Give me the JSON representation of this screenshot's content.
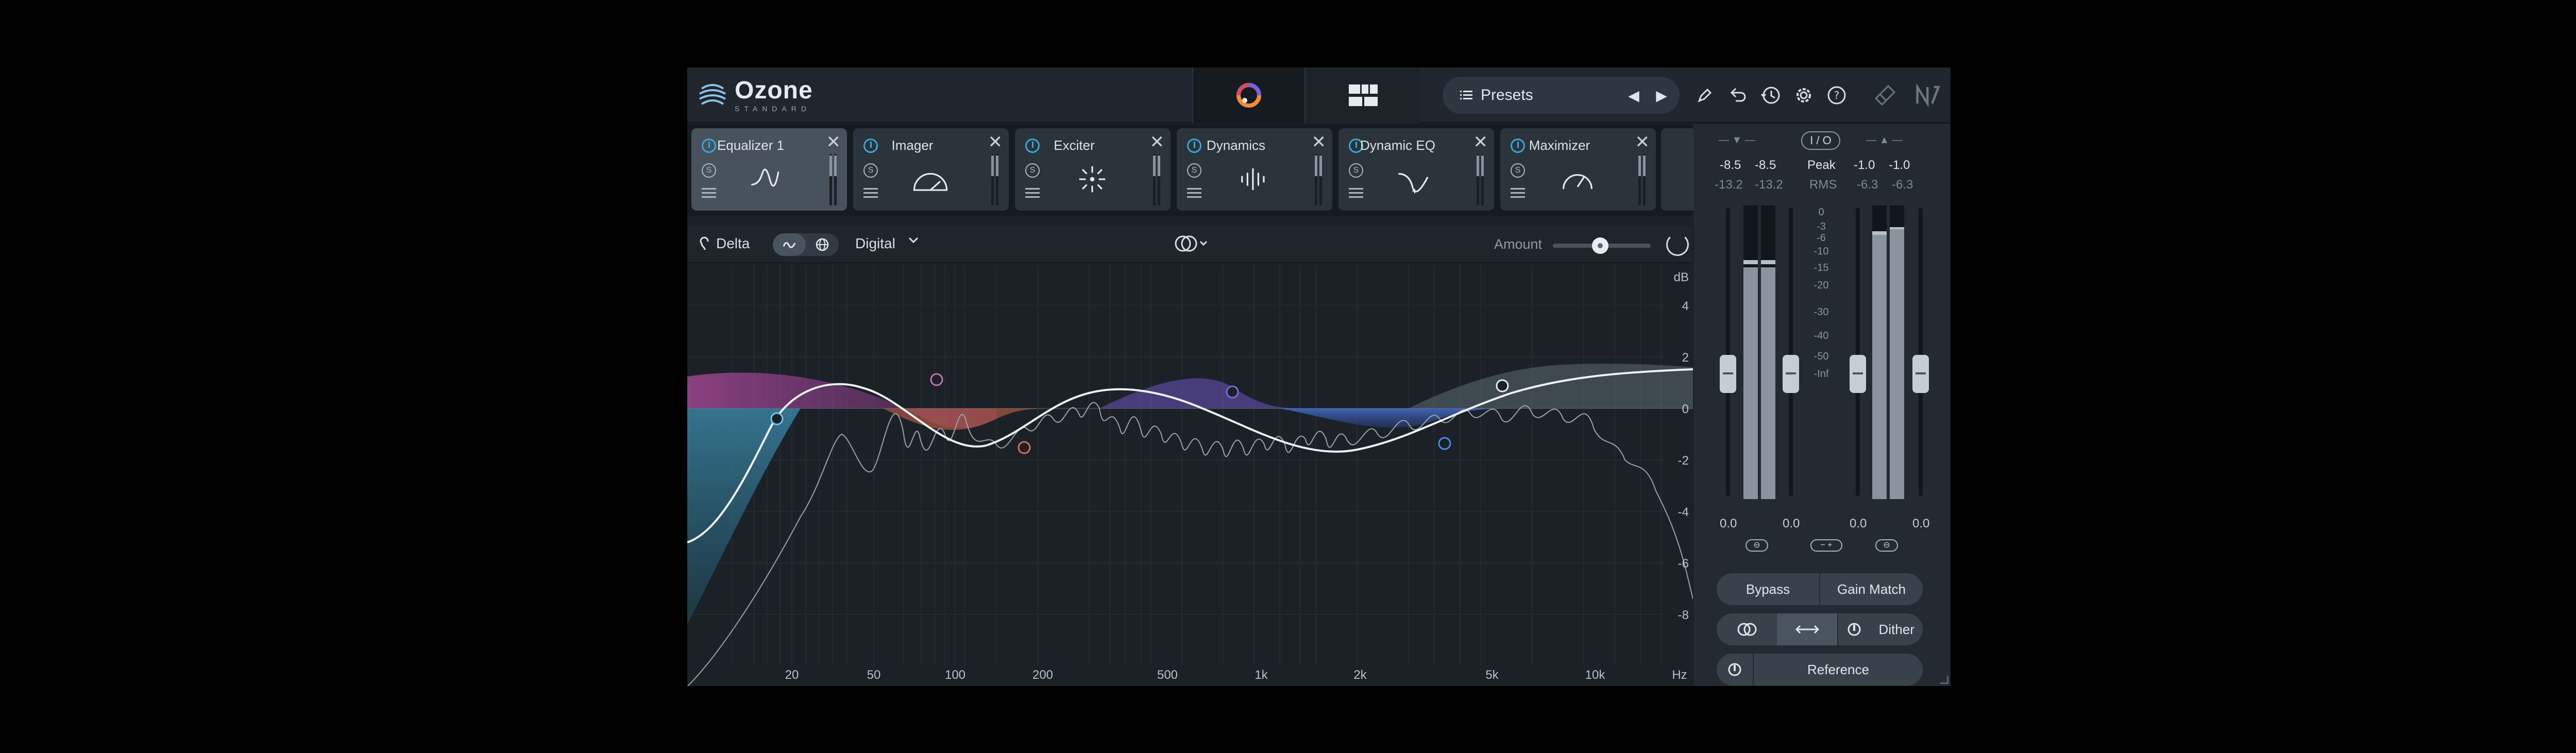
{
  "app": {
    "logo_title": "Ozone",
    "logo_subtitle": "STANDARD"
  },
  "topbar": {
    "presets_label": "Presets",
    "icons": [
      "ring-visualizer-icon",
      "module-grid-icon",
      "pencil-icon",
      "undo-icon",
      "history-icon",
      "gear-icon",
      "help-icon",
      "plugin-link-icon",
      "ni-logo-icon"
    ]
  },
  "modules": [
    {
      "name": "Equalizer 1",
      "active": true,
      "icon": "eq-curve-icon"
    },
    {
      "name": "Imager",
      "active": false,
      "icon": "imager-arc-icon"
    },
    {
      "name": "Exciter",
      "active": false,
      "icon": "exciter-burst-icon"
    },
    {
      "name": "Dynamics",
      "active": false,
      "icon": "dynamics-bars-icon"
    },
    {
      "name": "Dynamic EQ",
      "active": false,
      "icon": "dynamic-eq-icon"
    },
    {
      "name": "Maximizer",
      "active": false,
      "icon": "maximizer-gauge-icon"
    }
  ],
  "module_controls": {
    "solo": "S",
    "close": "✕"
  },
  "eq_header": {
    "delta_label": "Delta",
    "mode_label": "Digital",
    "amount_label": "Amount",
    "amount_value": 0.5
  },
  "graph": {
    "y_unit": "dB",
    "y_ticks": [
      "4",
      "2",
      "0",
      "-2",
      "-4",
      "-6",
      "-8"
    ],
    "x_unit": "Hz",
    "x_ticks": [
      "20",
      "50",
      "100",
      "200",
      "500",
      "1k",
      "2k",
      "5k",
      "10k"
    ]
  },
  "meters": {
    "io_label": "I / O",
    "input_peak": [
      "-8.5",
      "-8.5"
    ],
    "input_rms": [
      "-13.2",
      "-13.2"
    ],
    "peak_label": "Peak",
    "rms_label": "RMS",
    "output_peak": [
      "-1.0",
      "-1.0"
    ],
    "output_rms": [
      "-6.3",
      "-6.3"
    ],
    "scale": [
      "0",
      "-3",
      "-6",
      "-10",
      "-15",
      "-20",
      "-30",
      "-40",
      "-50",
      "-Inf"
    ],
    "gains": [
      "0.0",
      "0.0",
      "0.0",
      "0.0"
    ],
    "input_levels": [
      0.79,
      0.79
    ],
    "output_levels": [
      0.9,
      0.92
    ]
  },
  "side_buttons": {
    "bypass": "Bypass",
    "gain_match": "Gain Match",
    "dither": "Dither",
    "reference": "Reference"
  }
}
